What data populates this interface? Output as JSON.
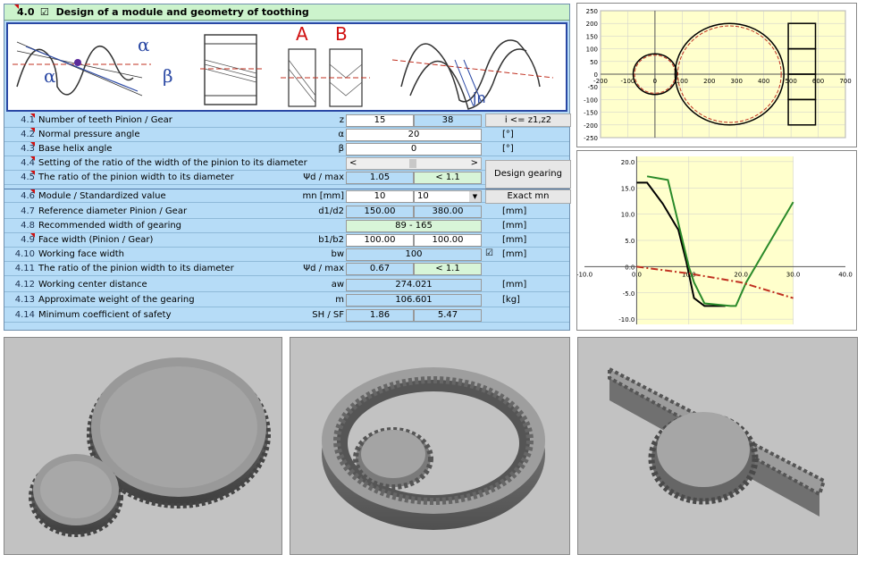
{
  "header": {
    "number": "4.0",
    "checkbox": "☑",
    "title": "Design of a module and geometry of toothing"
  },
  "diagram": {
    "alpha": "α",
    "beta": "β",
    "A": "A",
    "B": "B",
    "jn": "jn"
  },
  "rows": [
    {
      "n": "4.1",
      "label": "Number of teeth Pinion / Gear",
      "sym": "z",
      "v1": "15",
      "v2": "38"
    },
    {
      "n": "4.2",
      "label": "Normal pressure angle",
      "sym": "α",
      "v": "20",
      "unit": "[°]"
    },
    {
      "n": "4.3",
      "label": "Base helix angle",
      "sym": "β",
      "v": "0",
      "unit": "[°]"
    },
    {
      "n": "4.4",
      "label": "Setting of the ratio of the width of the pinion to its diameter",
      "scroll_left": "<",
      "scroll_right": ">"
    },
    {
      "n": "4.5",
      "label": "The ratio of the pinion width to its diameter",
      "sym": "Ψd / max",
      "v1": "1.05",
      "v2": "< 1.1"
    },
    {
      "n": "4.6",
      "label": "Module / Standardized value",
      "sym": "mn [mm]",
      "v1": "10",
      "select": "10"
    },
    {
      "n": "4.7",
      "label": "Reference diameter Pinion / Gear",
      "sym": "d1/d2",
      "v1": "150.00",
      "v2": "380.00",
      "unit": "[mm]"
    },
    {
      "n": "4.8",
      "label": "Recommended width of gearing",
      "v": "89 - 165",
      "unit": "[mm]"
    },
    {
      "n": "4.9",
      "label": "Face width (Pinion / Gear)",
      "sym": "b1/b2",
      "v1": "100.00",
      "v2": "100.00",
      "unit": "[mm]"
    },
    {
      "n": "4.10",
      "label": "Working face width",
      "sym": "bw",
      "v": "100",
      "check": "☑",
      "unit": "[mm]"
    },
    {
      "n": "4.11",
      "label": "The ratio of the pinion width to its diameter",
      "sym": "Ψd / max",
      "v1": "0.67",
      "v2": "< 1.1"
    },
    {
      "n": "4.12",
      "label": "Working center distance",
      "sym": "aw",
      "v": "274.021",
      "unit": "[mm]"
    },
    {
      "n": "4.13",
      "label": "Approximate weight of the gearing",
      "sym": "m",
      "v": "106.601",
      "unit": "[kg]"
    },
    {
      "n": "4.14",
      "label": "Minimum coefficient of safety",
      "sym": "SH / SF",
      "v1": "1.86",
      "v2": "5.47"
    }
  ],
  "buttons": {
    "ratio": "i <= z1,z2",
    "design": "Design gearing",
    "exact": "Exact mn",
    "select_arrow": "▼"
  },
  "colors": {
    "sheet": "#b6dcf7",
    "title": "#ccf3cc",
    "green_cell": "#d8f5d8",
    "chart_bg": "#ffffcc",
    "gear": "#8a8a8a",
    "panel_bg": "#c2c2c2"
  },
  "chart_data": [
    {
      "type": "scatter",
      "title": "",
      "x_ticks": [
        "-200",
        "-100",
        "0",
        "100",
        "200",
        "300",
        "400",
        "500",
        "600",
        "700"
      ],
      "y_ticks": [
        "250",
        "200",
        "150",
        "100",
        "50",
        "0",
        "-50",
        "-100",
        "-150",
        "-200",
        "-250"
      ],
      "xlim": [
        -200,
        700
      ],
      "ylim": [
        -250,
        250
      ],
      "grid": true
    },
    {
      "type": "line",
      "title": "",
      "x_ticks": [
        "-10.0",
        "0.0",
        "10.0",
        "20.0",
        "30.0",
        "40.0"
      ],
      "y_ticks": [
        "20.0",
        "15.0",
        "10.0",
        "5.0",
        "0.0",
        "-5.0",
        "-10.0"
      ],
      "xlim": [
        -10,
        40
      ],
      "ylim": [
        -11,
        21
      ],
      "grid": true,
      "series": [
        {
          "color": "#000000",
          "x": [
            0,
            2,
            5,
            8,
            9.5,
            11,
            13,
            15,
            17
          ],
          "y": [
            16,
            16,
            12,
            7,
            1,
            -6,
            -7.5,
            -7.5,
            -7.5
          ]
        },
        {
          "color": "#2a8a2a",
          "x": [
            2,
            6,
            10,
            11,
            13,
            18,
            19,
            21,
            30
          ],
          "y": [
            17.2,
            16.5,
            0,
            -3,
            -7,
            -7.5,
            -7.5,
            -3,
            12.3
          ]
        },
        {
          "color": "#c03020",
          "x": [
            0,
            10,
            20,
            30
          ],
          "y": [
            0,
            -1.3,
            -3,
            -6
          ]
        }
      ]
    }
  ],
  "panels": [
    "external spur gears",
    "internal ring gear",
    "rack and pinion"
  ]
}
